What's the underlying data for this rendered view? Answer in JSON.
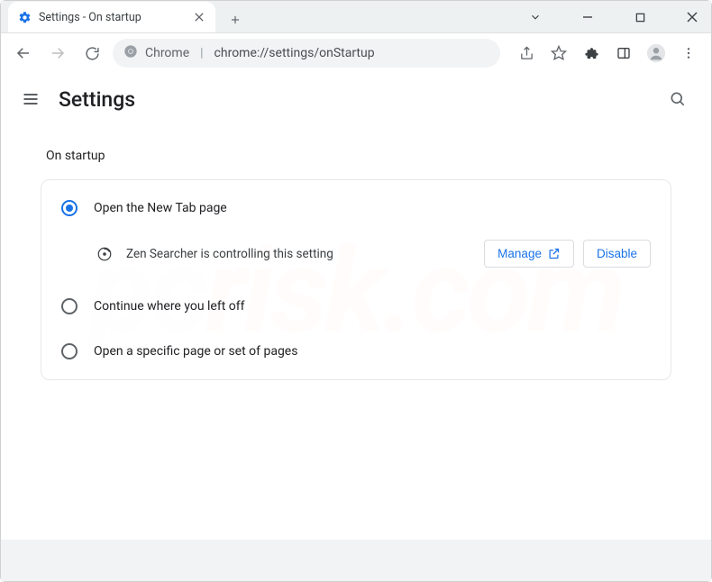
{
  "window": {
    "tab_title": "Settings - On startup"
  },
  "omnibox": {
    "origin": "Chrome",
    "path": "chrome://settings/onStartup"
  },
  "header": {
    "title": "Settings"
  },
  "section": {
    "title": "On startup"
  },
  "options": {
    "new_tab": "Open the New Tab page",
    "continue": "Continue where you left off",
    "specific": "Open a specific page or set of pages"
  },
  "extension": {
    "notice": "Zen Searcher is controlling this setting",
    "manage": "Manage",
    "disable": "Disable"
  }
}
